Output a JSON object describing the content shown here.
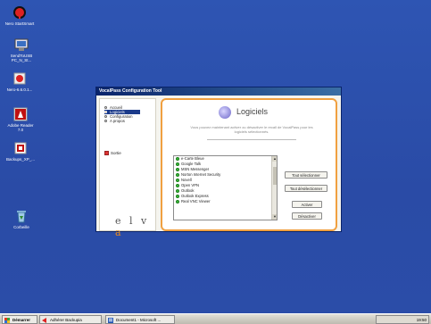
{
  "desktop": {
    "icons": [
      {
        "label": "Nero StartSmart",
        "icon": "nero-icon"
      },
      {
        "label": "SendToUSB\nPC_N_St...",
        "icon": "usb-drive-icon"
      },
      {
        "label": "Nero-6.6.0.1...",
        "icon": "nero-setup-icon"
      },
      {
        "label": "Adobe Reader\n7.0",
        "icon": "adobe-reader-icon"
      },
      {
        "label": "Backups_XP_...",
        "icon": "backup-icon"
      },
      {
        "label": "Corbeille",
        "icon": "recycle-bin-icon"
      }
    ]
  },
  "window": {
    "title": "VocalPass Configuration Tool",
    "menu": [
      {
        "label": "Accueil",
        "selected": false
      },
      {
        "label": "Logiciels",
        "selected": true
      },
      {
        "label": "Configuration",
        "selected": false
      },
      {
        "label": "A propos",
        "selected": false
      }
    ],
    "exit_label": "Sortie",
    "brand": {
      "before": "e l v ",
      "accent": "a"
    },
    "panel_title": "Logiciels",
    "description": "Vous pouvez maintenant activer ou désactiver le recall de VocalPass pour les logiciels sélectionnés.",
    "software_list": [
      "e-Carte Bleue",
      "Google Talk",
      "MSN Messenger",
      "Norton Internet Security",
      "Novell",
      "Open VPN",
      "Outlook",
      "Outlook Express",
      "Real VNC Viewer"
    ],
    "buttons": {
      "select_all": "Tout sélectionner",
      "deselect_all": "Tout désélectionner",
      "activate": "Activer",
      "deactivate": "Désactiver"
    }
  },
  "taskbar": {
    "start_label": "Démarrer",
    "tasks": [
      {
        "label": "Adhérer Backupia"
      },
      {
        "label": "Document1 - Microsoft ..."
      }
    ],
    "clock": "19:50"
  },
  "colors": {
    "accent": "#f0a040",
    "titlebar": "#0a246a",
    "desktop": "#2a4ea8"
  }
}
